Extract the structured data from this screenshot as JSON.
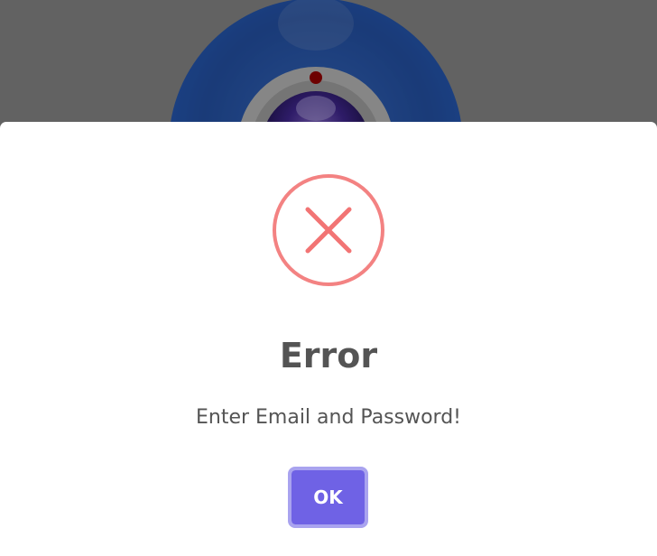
{
  "dialog": {
    "title": "Error",
    "message": "Enter Email and Password!",
    "confirm_label": "OK",
    "icon": "error-x-icon"
  },
  "colors": {
    "error": "#f27474",
    "confirm_button": "#7066e0",
    "confirm_focus_ring": "#a9a3ef",
    "title_text": "#545454",
    "backdrop": "#9e9e9e",
    "logo_blue": "#2f63c4"
  },
  "background": {
    "logo_icon": "camera-lens-logo-icon"
  }
}
